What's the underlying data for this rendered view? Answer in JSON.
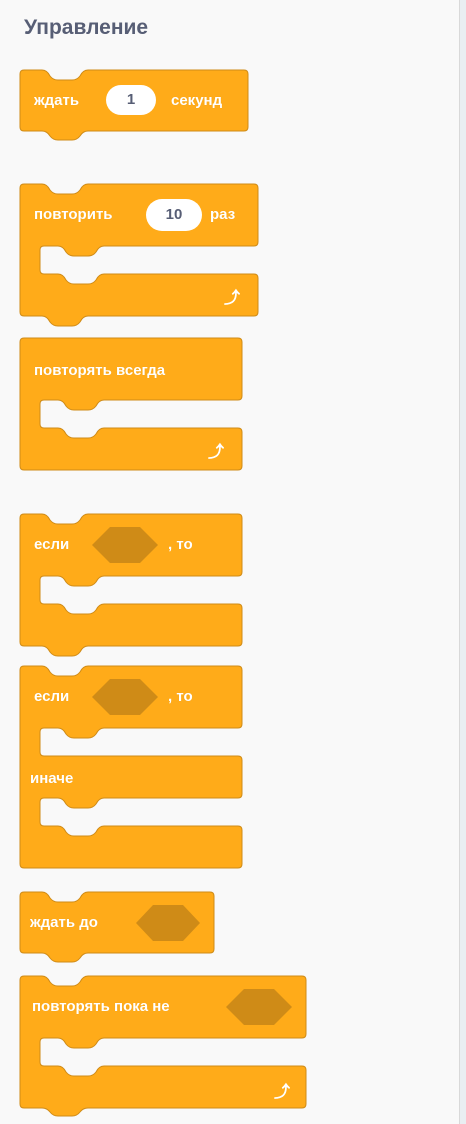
{
  "category": {
    "title": "Управление"
  },
  "colors": {
    "control": "#ffab19",
    "control_dark": "#cf8b17",
    "header_text": "#575e75"
  },
  "blocks": {
    "wait": {
      "label": "ждать",
      "value": "1",
      "suffix": "секунд"
    },
    "repeat": {
      "label": "повторить",
      "value": "10",
      "suffix": "раз",
      "loop_icon": "loop-arrow-icon"
    },
    "forever": {
      "label": "повторять всегда",
      "loop_icon": "loop-arrow-icon"
    },
    "if_then": {
      "label": "если",
      "suffix": ", то"
    },
    "if_else": {
      "label": "если",
      "suffix": ", то",
      "else_label": "иначе"
    },
    "wait_until": {
      "label": "ждать до"
    },
    "repeat_until": {
      "label": "повторять пока не",
      "loop_icon": "loop-arrow-icon"
    }
  }
}
